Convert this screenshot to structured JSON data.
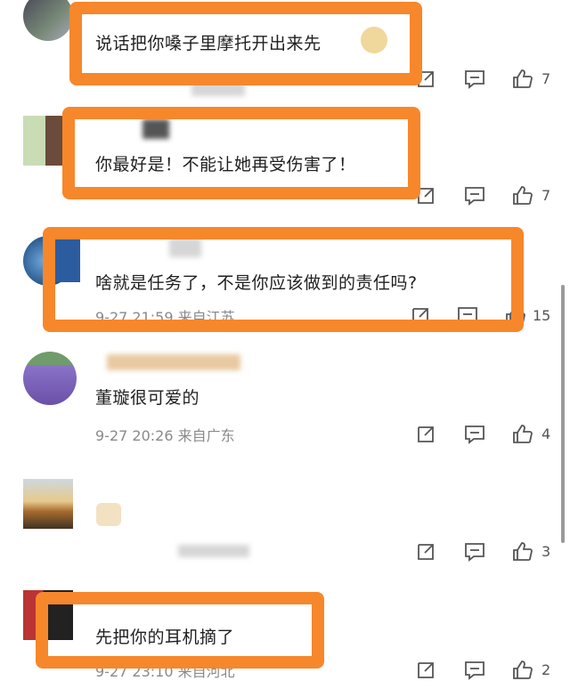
{
  "comments": [
    {
      "text": "说话把你嗓子里摩托开出来先",
      "meta": "",
      "likes": "7"
    },
    {
      "text": "你最好是！不能让她再受伤害了！",
      "meta": "",
      "likes": "7"
    },
    {
      "text": "啥就是任务了，不是你应该做到的责任吗?",
      "meta": "9-27 21:59 来自江苏",
      "likes": "15"
    },
    {
      "text": "董璇很可爱的",
      "meta": "9-27 20:26 来自广东",
      "likes": "4"
    },
    {
      "text": "",
      "meta": "",
      "likes": "3"
    },
    {
      "text": "先把你的耳机摘了",
      "meta": "9-27 23:10 来自河北",
      "likes": "2"
    }
  ],
  "highlight_color": "#f7872b",
  "icons": [
    "share-icon",
    "comment-icon",
    "like-icon"
  ]
}
